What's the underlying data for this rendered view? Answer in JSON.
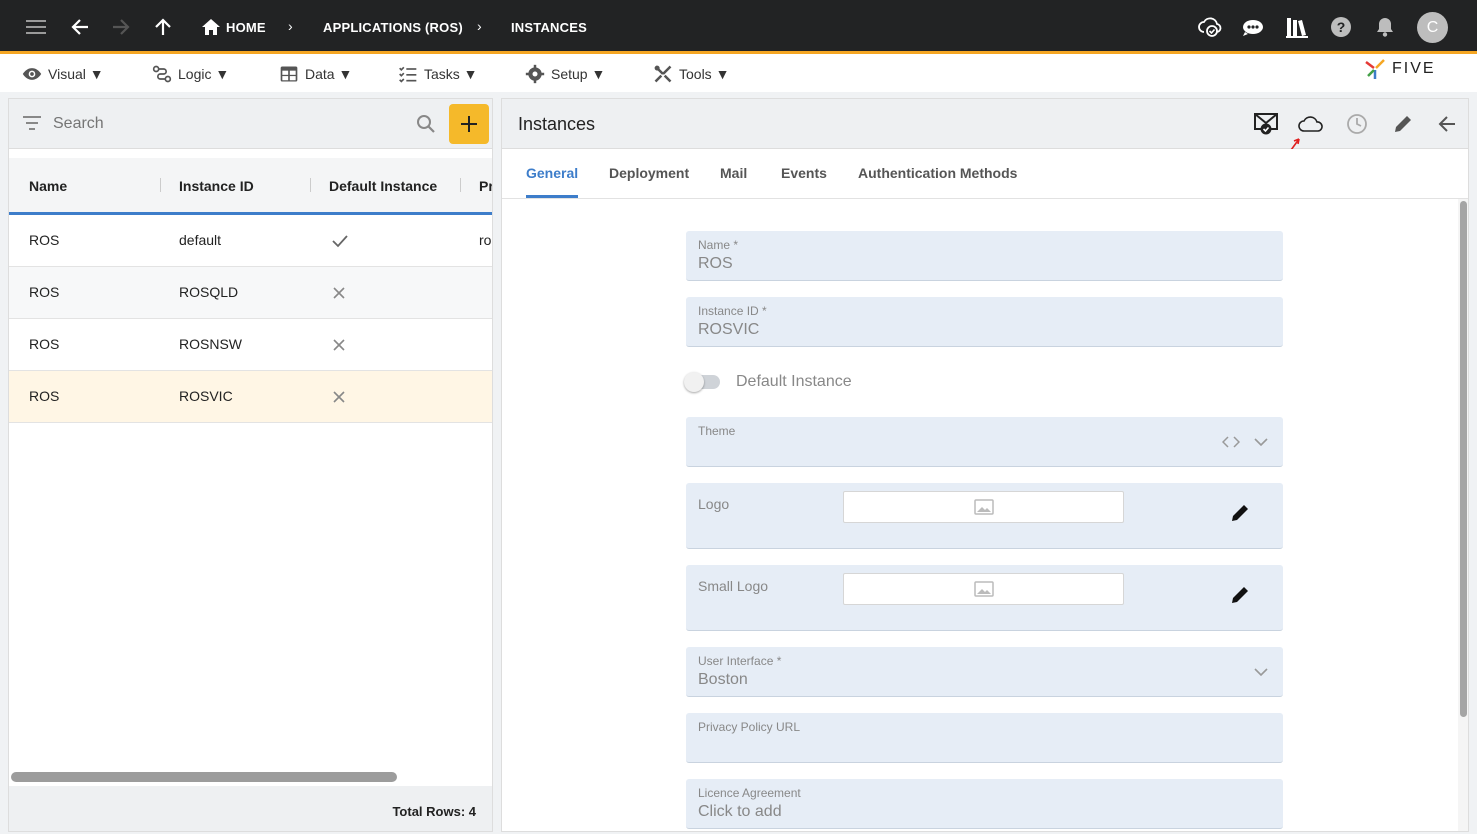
{
  "breadcrumbs": [
    "HOME",
    "APPLICATIONS (ROS)",
    "INSTANCES"
  ],
  "user": {
    "avatar_initial": "C"
  },
  "menu": [
    {
      "label": "Visual ▼",
      "icon": "eye-icon"
    },
    {
      "label": "Logic ▼",
      "icon": "flow-icon"
    },
    {
      "label": "Data ▼",
      "icon": "table-icon"
    },
    {
      "label": "Tasks ▼",
      "icon": "checklist-icon"
    },
    {
      "label": "Setup ▼",
      "icon": "gear-icon"
    },
    {
      "label": "Tools ▼",
      "icon": "tools-icon"
    }
  ],
  "brand": {
    "name": "FIVE"
  },
  "search": {
    "placeholder": "Search"
  },
  "table": {
    "columns": [
      "Name",
      "Instance ID",
      "Default Instance",
      "Pr"
    ],
    "rows": [
      {
        "name": "ROS",
        "instance_id": "default",
        "default": true,
        "extra": "ro"
      },
      {
        "name": "ROS",
        "instance_id": "ROSQLD",
        "default": false,
        "extra": ""
      },
      {
        "name": "ROS",
        "instance_id": "ROSNSW",
        "default": false,
        "extra": ""
      },
      {
        "name": "ROS",
        "instance_id": "ROSVIC",
        "default": false,
        "extra": "",
        "selected": true
      }
    ],
    "total_rows": "Total Rows: 4"
  },
  "form": {
    "title": "Instances",
    "tabs": [
      "General",
      "Deployment",
      "Mail",
      "Events",
      "Authentication Methods"
    ],
    "active_tab": "General",
    "fields": {
      "name": {
        "label": "Name *",
        "value": "ROS"
      },
      "instance_id": {
        "label": "Instance ID *",
        "value": "ROSVIC"
      },
      "default_instance": {
        "label": "Default Instance",
        "on": false
      },
      "theme": {
        "label": "Theme",
        "value": ""
      },
      "logo": {
        "label": "Logo"
      },
      "small_logo": {
        "label": "Small Logo"
      },
      "user_interface": {
        "label": "User Interface *",
        "value": "Boston"
      },
      "privacy_policy_url": {
        "label": "Privacy Policy URL",
        "value": ""
      },
      "licence_agreement": {
        "label": "Licence Agreement",
        "value": "Click to add"
      }
    }
  },
  "colors": {
    "accent": "#f5a623",
    "primary": "#3d7dca",
    "selected_row": "#fff6e5",
    "add_button": "#f5b92a"
  }
}
